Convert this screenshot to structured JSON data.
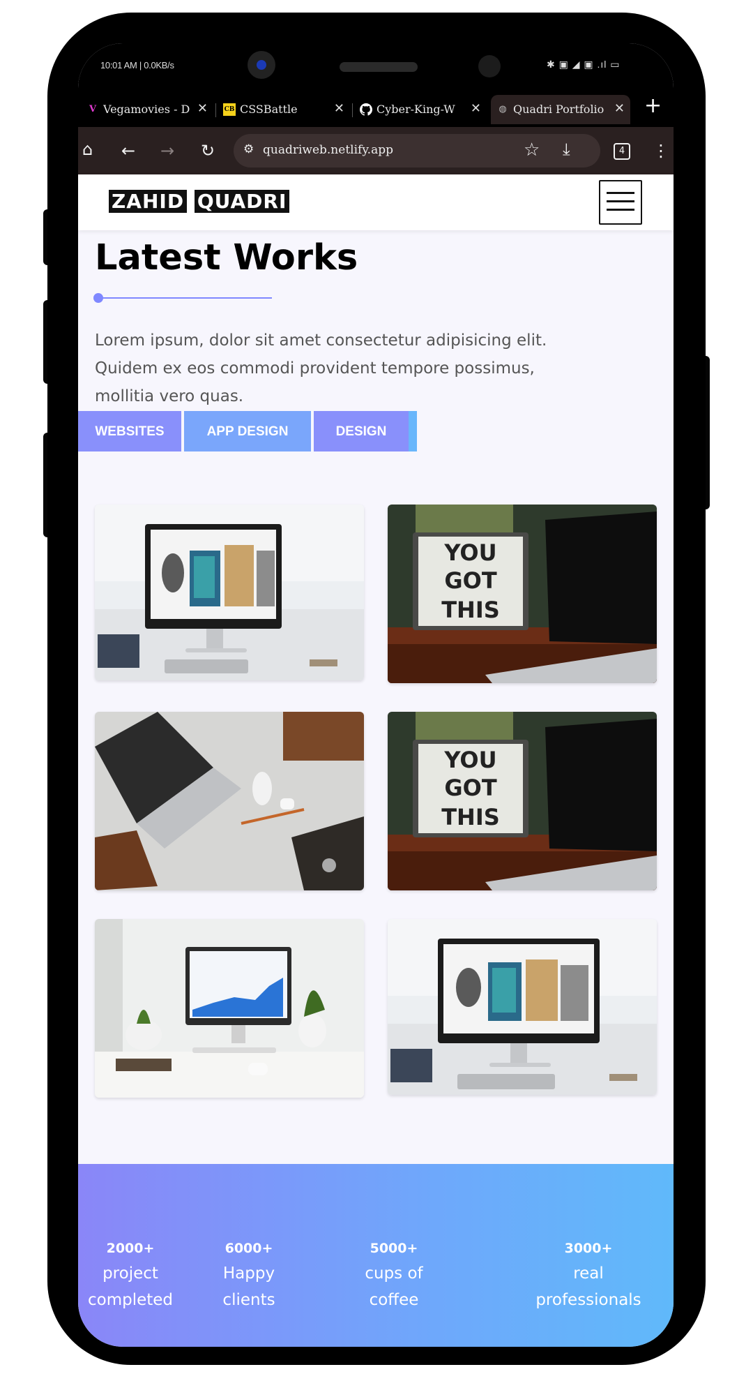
{
  "status": {
    "time": "10:01 AM | 0.0KB/s",
    "icons": "✱ ▣ ◢ ▣ .ıl ▭"
  },
  "browser": {
    "tabs": [
      {
        "icon": "V",
        "icon_color": "#e23bd0",
        "label": "Vegamovies - D",
        "active": false
      },
      {
        "icon": "CB",
        "icon_color": "#f6d21b",
        "label": "CSSBattle",
        "active": false
      },
      {
        "icon": "github-icon",
        "icon_color": "#ffffff",
        "label": "Cyber-King-W",
        "active": false
      },
      {
        "icon": "globe-icon",
        "icon_color": "#bbbbbb",
        "label": "Quadri Portfolio",
        "active": true
      }
    ],
    "url": "quadriweb.netlify.app",
    "tab_count": "4"
  },
  "site": {
    "logo_first": "ZAHID",
    "logo_second": "QUADRI",
    "section_title": "Latest Works",
    "description": "Lorem ipsum, dolor sit amet consectetur adipisicing elit. Quidem ex eos commodi provident tempore possimus, mollitia vero quas.",
    "filters": [
      {
        "label": "WEBSITES",
        "color": "#8990fb"
      },
      {
        "label": "APP DESIGN",
        "color": "#7aa6fb"
      },
      {
        "label": "DESIGN",
        "color": "#8990fb"
      },
      {
        "label": "",
        "color": "#69b6fb"
      }
    ],
    "portfolio": [
      {
        "image": "imac-gallery-desk"
      },
      {
        "image": "you-got-this-lightbox",
        "text": [
          "YOU",
          "GOT",
          "THIS"
        ]
      },
      {
        "image": "laptop-flatlay"
      },
      {
        "image": "you-got-this-lightbox",
        "text": [
          "YOU",
          "GOT",
          "THIS"
        ]
      },
      {
        "image": "imac-chart-plants"
      },
      {
        "image": "imac-gallery-desk"
      }
    ],
    "stats": [
      {
        "number": "2000+",
        "line1": "project",
        "line2": "completed"
      },
      {
        "number": "6000+",
        "line1": "Happy",
        "line2": "clients"
      },
      {
        "number": "5000+",
        "line1": "cups of",
        "line2": "coffee"
      },
      {
        "number": "3000+",
        "line1": "real",
        "line2": "professionals"
      }
    ]
  }
}
